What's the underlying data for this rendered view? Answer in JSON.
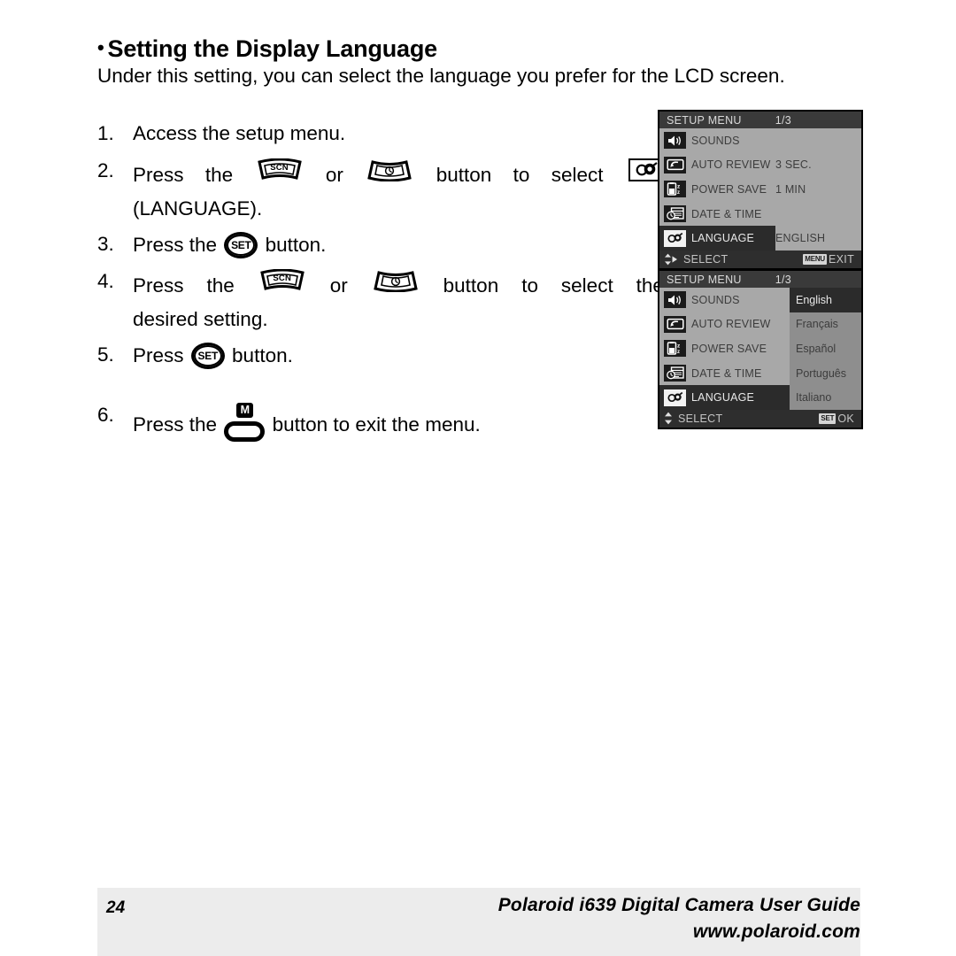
{
  "document": {
    "heading_bullet": "•",
    "heading": "Setting the Display Language",
    "intro": "Under this setting, you can select the language you prefer for the LCD screen."
  },
  "steps": [
    {
      "num": "1.",
      "text": "Access the setup menu."
    },
    {
      "num": "2.",
      "pre": "Press",
      "the1": "the",
      "btn1_label": "SCN",
      "or": "or",
      "btn2_label": "self-timer",
      "mid": "button",
      "to": "to",
      "select": "select",
      "line2": "(LANGUAGE)."
    },
    {
      "num": "3.",
      "pre": "Press the",
      "btn_label": "SET",
      "post": "button."
    },
    {
      "num": "4.",
      "pre": "Press",
      "the1": "the",
      "btn1_label": "SCN",
      "or": "or",
      "btn2_label": "self-timer",
      "mid": "button",
      "to": "to",
      "select": "select",
      "the2": "the",
      "line2": "desired setting."
    },
    {
      "num": "5.",
      "pre": "Press",
      "btn_label": "SET",
      "post": "button."
    },
    {
      "num": "6.",
      "pre": "Press the",
      "btn_label": "M",
      "post": "button to exit the menu."
    }
  ],
  "lcd_screens": [
    {
      "id": "setup-menu-page",
      "header_title": "SETUP MENU",
      "header_page": "1/3",
      "rows": [
        {
          "icon": "speaker-icon",
          "label": "SOUNDS",
          "value": "",
          "selected": false
        },
        {
          "icon": "auto-review-icon",
          "label": "AUTO REVIEW",
          "value": "3 SEC.",
          "selected": false
        },
        {
          "icon": "power-save-icon",
          "label": "POWER SAVE",
          "value": "1 MIN",
          "selected": false
        },
        {
          "icon": "date-time-icon",
          "label": "DATE & TIME",
          "value": "",
          "selected": false
        },
        {
          "icon": "language-icon",
          "label": "LANGUAGE",
          "value": "ENGLISH",
          "selected": true
        }
      ],
      "footer_select": "SELECT",
      "footer_action_tag": "MENU",
      "footer_action": "EXIT",
      "arrows": "up-down-right"
    },
    {
      "id": "language-options-page",
      "header_title": "SETUP MENU",
      "header_page": "1/3",
      "rows": [
        {
          "icon": "speaker-icon",
          "label": "SOUNDS",
          "value": "",
          "selected": false
        },
        {
          "icon": "auto-review-icon",
          "label": "AUTO REVIEW",
          "value": "",
          "selected": false
        },
        {
          "icon": "power-save-icon",
          "label": "POWER SAVE",
          "value": "",
          "selected": false
        },
        {
          "icon": "date-time-icon",
          "label": "DATE & TIME",
          "value": "",
          "selected": false
        },
        {
          "icon": "language-icon",
          "label": "LANGUAGE",
          "value": "",
          "selected": true
        }
      ],
      "languages": [
        {
          "label": "English",
          "active": true
        },
        {
          "label": "Français",
          "active": false
        },
        {
          "label": "Español",
          "active": false
        },
        {
          "label": "Português",
          "active": false
        },
        {
          "label": "Italiano",
          "active": false
        }
      ],
      "footer_select": "SELECT",
      "footer_action_tag": "SET",
      "footer_action": "OK",
      "arrows": "up-down"
    }
  ],
  "footer": {
    "page_number": "24",
    "guide_title": "Polaroid i639 Digital Camera User Guide",
    "website": "www.polaroid.com"
  },
  "colors": {
    "lcd_background": "#a8a8a8",
    "lcd_right_panel": "#8e8e8e",
    "lcd_header": "#3a3a3a",
    "lcd_footer": "#2e2e2e",
    "lcd_highlight": "#2b2b2b",
    "page_footer_band": "#ececec",
    "text": "#000000"
  }
}
